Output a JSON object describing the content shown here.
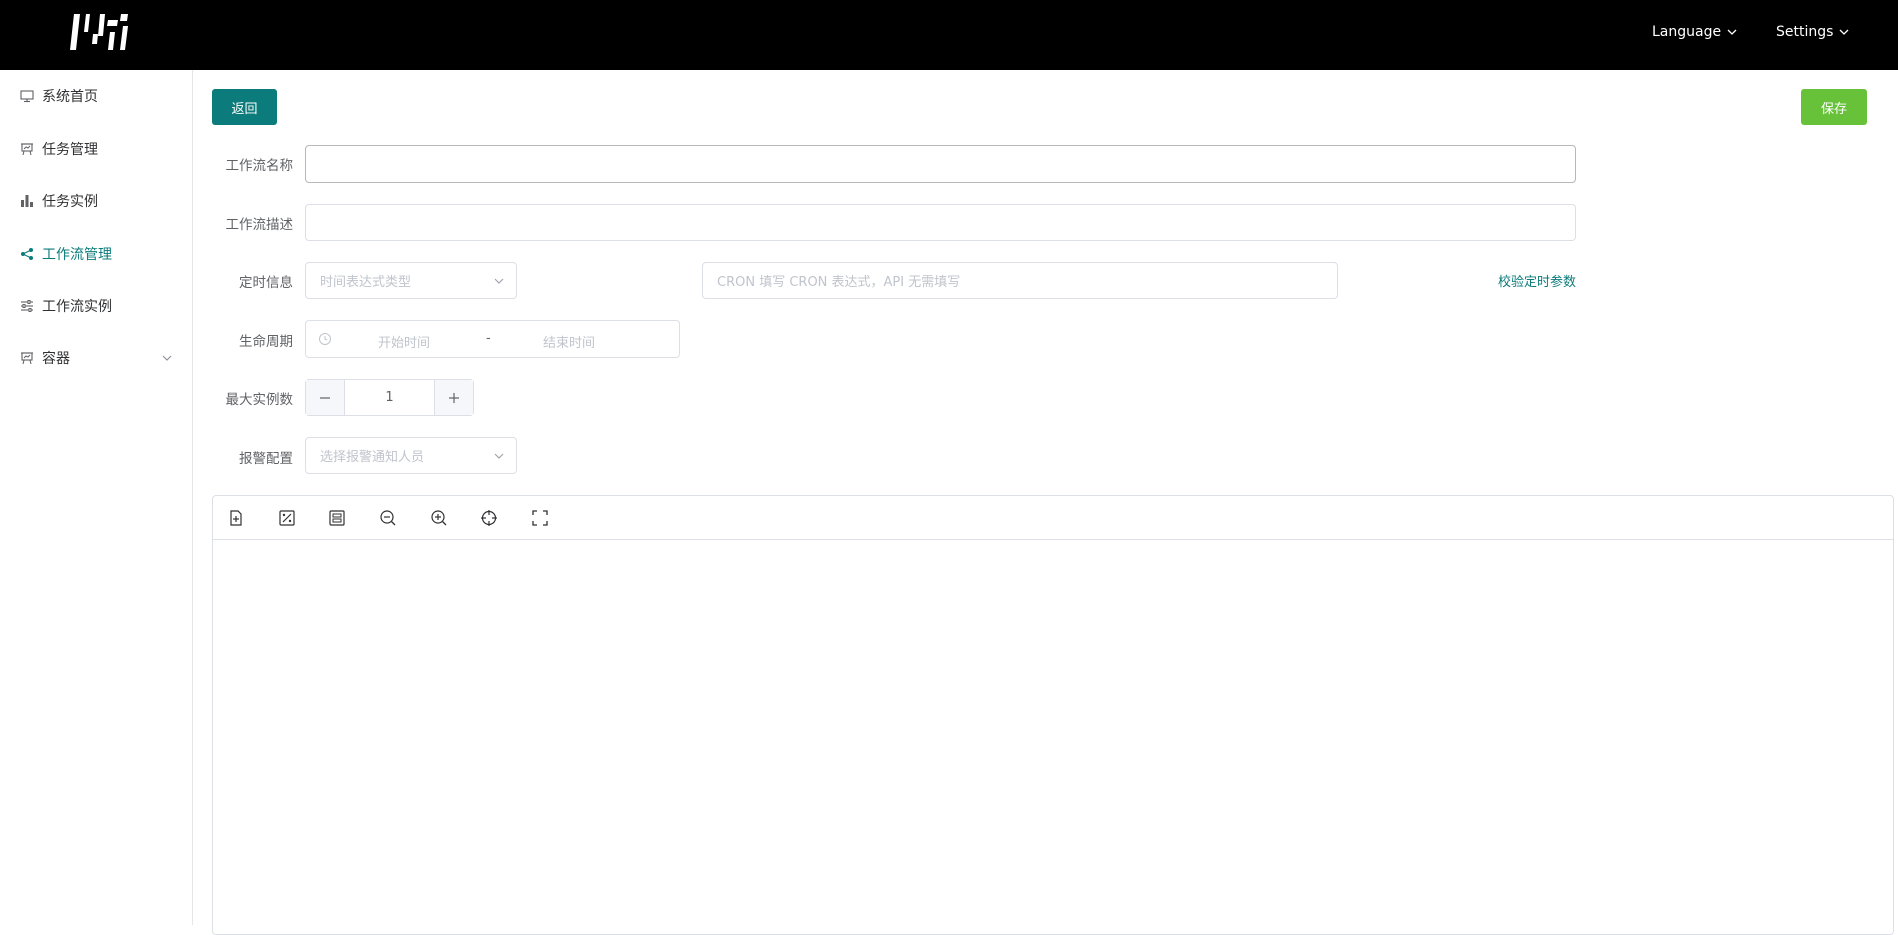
{
  "header": {
    "language_label": "Language",
    "settings_label": "Settings"
  },
  "sidebar": {
    "items": [
      {
        "label": "系统首页",
        "icon": "monitor-icon"
      },
      {
        "label": "任务管理",
        "icon": "presentation-icon"
      },
      {
        "label": "任务实例",
        "icon": "bar-chart-icon"
      },
      {
        "label": "工作流管理",
        "icon": "share-icon",
        "active": true
      },
      {
        "label": "工作流实例",
        "icon": "sliders-icon"
      },
      {
        "label": "容器",
        "icon": "presentation-icon",
        "expandable": true
      }
    ]
  },
  "actions": {
    "back_label": "返回",
    "save_label": "保存"
  },
  "form": {
    "name_label": "工作流名称",
    "name_value": "",
    "desc_label": "工作流描述",
    "desc_value": "",
    "timing_label": "定时信息",
    "timing_type_placeholder": "时间表达式类型",
    "cron_placeholder": "CRON 填写 CRON 表达式，API 无需填写",
    "validate_link": "校验定时参数",
    "lifecycle_label": "生命周期",
    "lifecycle_start_placeholder": "开始时间",
    "lifecycle_separator": "-",
    "lifecycle_end_placeholder": "结束时间",
    "max_instances_label": "最大实例数",
    "max_instances_value": "1",
    "alarm_label": "报警配置",
    "alarm_placeholder": "选择报警通知人员"
  },
  "canvas_toolbar": {
    "tools": [
      "add-node-icon",
      "percent-icon",
      "layout-icon",
      "zoom-out-icon",
      "zoom-in-icon",
      "crosshair-icon",
      "fullscreen-icon"
    ]
  },
  "colors": {
    "primary": "#0c7b7b",
    "success": "#67c23a",
    "topbar": "#000000"
  }
}
